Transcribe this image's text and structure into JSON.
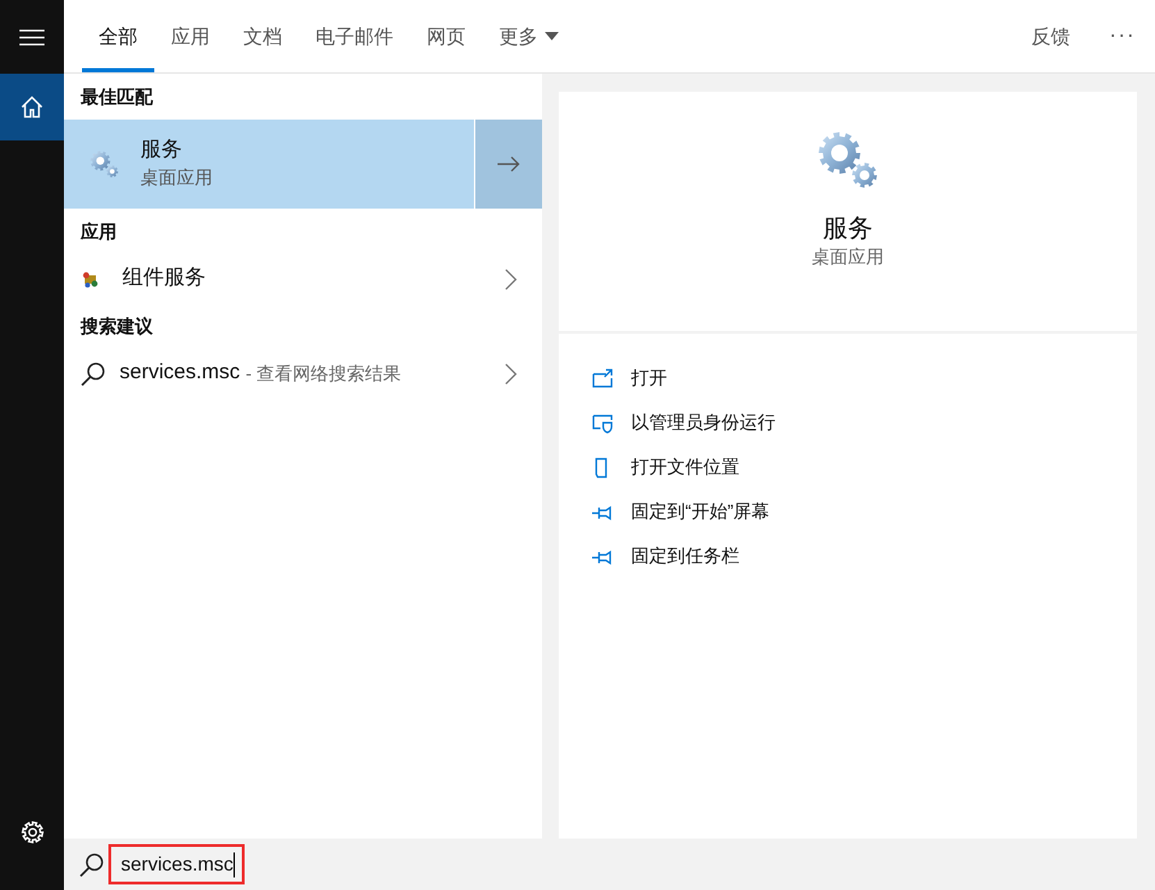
{
  "tabs": [
    {
      "label": "全部",
      "selected": true
    },
    {
      "label": "应用",
      "selected": false
    },
    {
      "label": "文档",
      "selected": false
    },
    {
      "label": "电子邮件",
      "selected": false
    },
    {
      "label": "网页",
      "selected": false
    },
    {
      "label": "更多",
      "selected": false,
      "dropdown": true
    }
  ],
  "header_actions": [
    {
      "kind": "feedback",
      "label": "反馈"
    },
    {
      "kind": "more",
      "label": "···"
    }
  ],
  "sections": [
    {
      "heading": "最佳匹配",
      "items": [
        {
          "kind": "best",
          "title": "服务",
          "subtitle": "桌面应用",
          "selected": true
        }
      ]
    },
    {
      "heading": "应用",
      "items": [
        {
          "kind": "app",
          "title": "组件服务"
        }
      ]
    },
    {
      "heading": "搜索建议",
      "items": [
        {
          "kind": "web",
          "title": "services.msc",
          "suffix": "- 查看网络搜索结果"
        }
      ]
    }
  ],
  "detail": {
    "title": "服务",
    "subtitle": "桌面应用",
    "actions": [
      {
        "kind": "open",
        "label": "打开"
      },
      {
        "kind": "admin",
        "label": "以管理员身份运行"
      },
      {
        "kind": "location",
        "label": "打开文件位置"
      },
      {
        "kind": "pin",
        "label": "固定到“开始”屏幕"
      },
      {
        "kind": "pin",
        "label": "固定到任务栏"
      }
    ]
  },
  "search": {
    "value": "services.msc",
    "highlighted": true
  }
}
